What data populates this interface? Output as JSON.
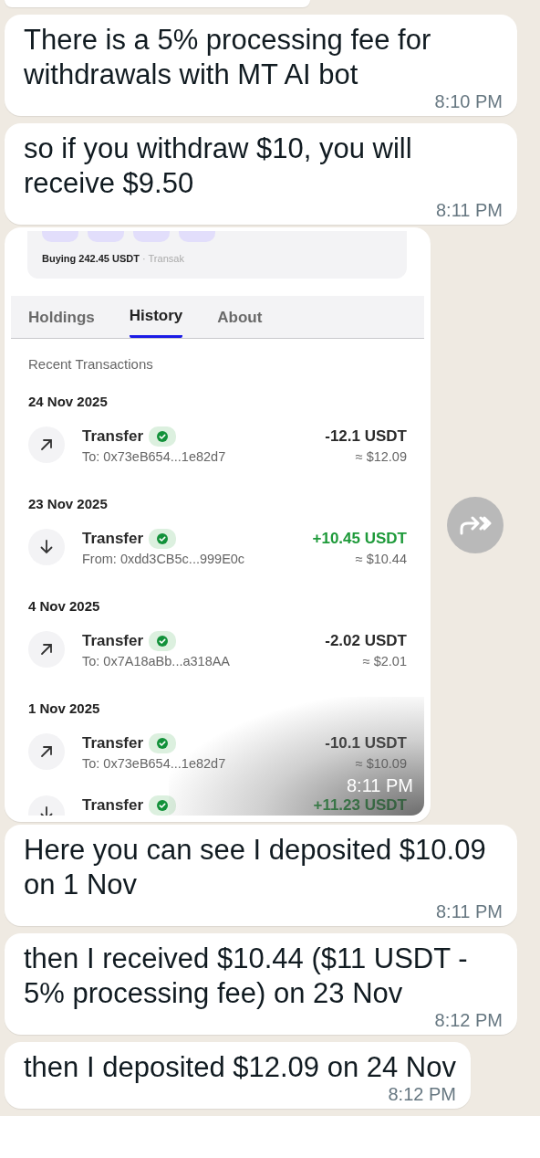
{
  "messages": [
    {
      "kind": "partial"
    },
    {
      "kind": "text",
      "text": "There is a 5% processing fee for withdrawals with MT AI bot",
      "time": "8:10 PM"
    },
    {
      "kind": "text",
      "text": "so if you withdraw $10, you will receive $9.50",
      "time": "8:11 PM"
    },
    {
      "kind": "image",
      "time": "8:11 PM",
      "screenshot": {
        "card": {
          "title": "Buying 242.45 USDT",
          "source": "· Transak"
        },
        "tabs": [
          {
            "label": "Holdings",
            "selected": false
          },
          {
            "label": "History",
            "selected": true
          },
          {
            "label": "About",
            "selected": false
          }
        ],
        "section_title": "Recent Transactions",
        "groups": [
          {
            "date": "24 Nov 2025",
            "transactions": [
              {
                "kind": "outgoing",
                "title": "Transfer",
                "verified": true,
                "address": "To: 0x73eB654...1e82d7",
                "amount": "-12.1 USDT",
                "approx": "≈ $12.09"
              }
            ]
          },
          {
            "date": "23 Nov 2025",
            "transactions": [
              {
                "kind": "incoming",
                "title": "Transfer",
                "verified": true,
                "address": "From: 0xdd3CB5c...999E0c",
                "amount": "+10.45 USDT",
                "approx": "≈ $10.44"
              }
            ]
          },
          {
            "date": "4 Nov 2025",
            "transactions": [
              {
                "kind": "outgoing",
                "title": "Transfer",
                "verified": true,
                "address": "To: 0x7A18aBb...a318AA",
                "amount": "-2.02 USDT",
                "approx": "≈ $2.01"
              }
            ]
          },
          {
            "date": "1 Nov 2025",
            "transactions": [
              {
                "kind": "outgoing",
                "title": "Transfer",
                "verified": true,
                "address": "To: 0x73eB654...1e82d7",
                "amount": "-10.1 USDT",
                "approx": "≈ $10.09"
              },
              {
                "kind": "incoming",
                "title": "Transfer",
                "verified": true,
                "amount": "+11.23 USDT"
              }
            ]
          }
        ]
      }
    },
    {
      "kind": "text",
      "text": "Here you can see I deposited $10.09 on 1 Nov",
      "time": "8:11 PM"
    },
    {
      "kind": "text",
      "text": "then I received $10.44 ($11 USDT - 5% processing fee) on 23 Nov",
      "time": "8:12 PM"
    },
    {
      "kind": "text",
      "text": "then I deposited $12.09 on 24 Nov",
      "time": "8:12 PM"
    }
  ]
}
